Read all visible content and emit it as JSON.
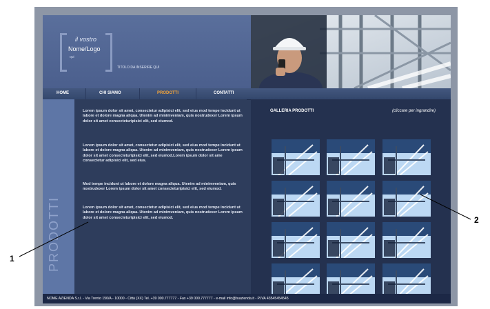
{
  "logo": {
    "line1": "il vostro",
    "line2": "Nome/Logo",
    "line3": "qui"
  },
  "tagline": "TITOLO DA INSERIRE QUI",
  "nav": [
    "HOME",
    "CHI SIAMO",
    "PRODOTTI",
    "CONTATTI"
  ],
  "nav_active": "PRODOTTI",
  "sidebar_title": "PRODOTTI",
  "paragraphs": [
    "Lorem ipsum dolor sit amet, consectetur adipisici elit, sed eius mod tempe incidunt ut labore et dolore magna aliqua. Utenim ad minimveniam, quis nostrudexer Lorem ipsum dolor sit amet consecteturipisici elit, sed eiumod.",
    "Lorem ipsum dolor sit amet, consectetur adipisici elit, sed eius mod tempe incidunt ut labore et dolore magna aliqua. Utenim ad minimveniam, quis nostrudexer Lorem ipsum dolor sit amet consecteturipisici elit, sed eiumod.Lorem ipsum dolor sit ame consectetur adipisici elit, sed eius.",
    "Mod tempe incidunt ut labore et dolore magna aliqua. Utenim ad minimveniam, quis nostrudexer Lorem ipsum dolor sit amet consecteturipisici elit, sed eiumod.",
    "Lorem ipsum dolor sit amet, consectetur adipisici elit, sed eius mod tempe incidunt ut labore et dolore magna aliqua. Utenim ad minimveniam, quis nostrudexer Lorem ipsum dolor sit amet consecteturipisici elit, sed eiumod."
  ],
  "gallery": {
    "title": "GALLERIA PRODOTTI",
    "hint": "(cliccare per ingrandire)"
  },
  "footer": "NOME AZIENDA S.r.l. - Via Trento 150/A - 10000 - Città (XX)  Tel. +39 000.777777 - Fax +39 000.777777 - e-mail info@tuazienda.it - P.IVA 43545454545",
  "annotations": [
    "1",
    "2"
  ],
  "colors": {
    "accent_nav_active": "#f0a33a",
    "header": "#4b5f8d",
    "sidebar": "#5e76a6",
    "footer": "#1c2846"
  }
}
